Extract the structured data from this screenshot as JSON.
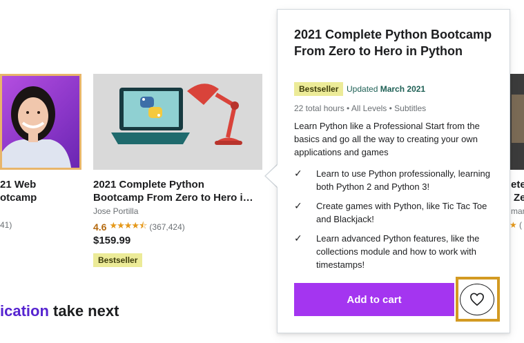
{
  "courses": {
    "left": {
      "title_line1": "21 Web",
      "title_line2": "otcamp",
      "rating_count": "41)"
    },
    "main": {
      "title_line1": "2021 Complete Python",
      "title_line2": "Bootcamp From Zero to Hero i…",
      "instructor": "Jose Portilla",
      "rating": "4.6",
      "stars": "★★★★⯪",
      "rating_count": "(367,424)",
      "price": "$159.99",
      "badge": "Bestseller"
    },
    "right": {
      "title_line1": "ete",
      "title_line2": "Ze",
      "instructor": "man",
      "rating_count": "("
    }
  },
  "section": {
    "accent": "ication",
    "rest": " take next"
  },
  "popover": {
    "title": "2021 Complete Python Bootcamp From Zero to Hero in Python",
    "badge": "Bestseller",
    "updated_label": "Updated",
    "updated_date": "March 2021",
    "meta": "22 total hours • All Levels • Subtitles",
    "description": "Learn Python like a Professional Start from the basics and go all the way to creating your own applications and games",
    "bullets": [
      "Learn to use Python professionally, learning both Python 2 and Python 3!",
      "Create games with Python, like Tic Tac Toe and Blackjack!",
      "Learn advanced Python features, like the collections module and how to work with timestamps!"
    ],
    "cart_button": "Add to cart",
    "check_glyph": "✓"
  },
  "colors": {
    "brand_purple": "#a435f0",
    "accent_purple": "#5624d0",
    "badge_yellow": "#eceb98",
    "highlight_outline": "#d39a22",
    "rating_orange": "#b4690e"
  },
  "icons": {
    "wishlist": "heart-icon",
    "bullet": "check-icon"
  }
}
